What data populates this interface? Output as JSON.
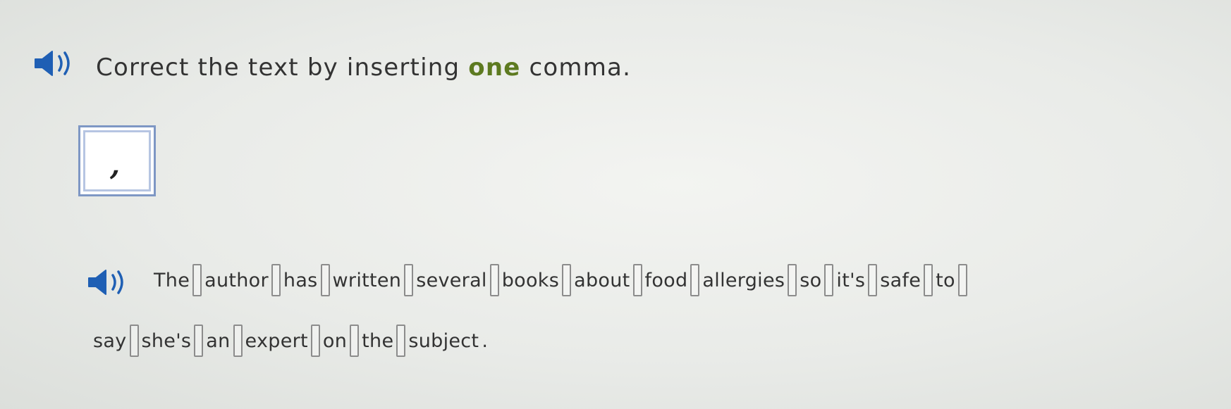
{
  "instruction": {
    "prefix": "Correct the text by inserting ",
    "emphasis": "one",
    "suffix": " comma.",
    "audio_icon": "speaker-icon",
    "accent_color": "#5d7a20"
  },
  "comma_tile": {
    "glyph": ",",
    "border_color": "#7e97c4"
  },
  "sentence": {
    "audio_icon": "speaker-icon",
    "line1": [
      "The",
      "author",
      "has",
      "written",
      "several",
      "books",
      "about",
      "food",
      "allergies",
      "so",
      "it's",
      "safe",
      "to"
    ],
    "line2": [
      "say",
      "she's",
      "an",
      "expert",
      "on",
      "the",
      "subject"
    ],
    "ending": "."
  }
}
